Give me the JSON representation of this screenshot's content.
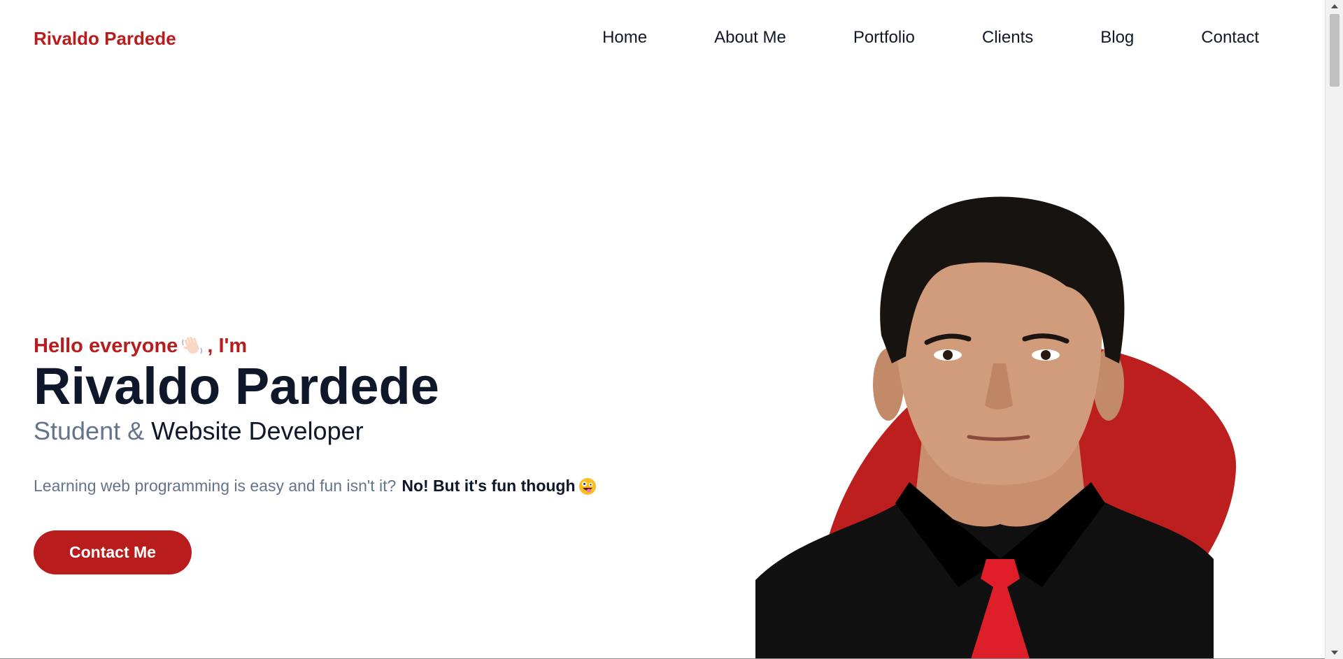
{
  "nav": {
    "brand": "Rivaldo Pardede",
    "links": [
      "Home",
      "About Me",
      "Portfolio",
      "Clients",
      "Blog",
      "Contact"
    ]
  },
  "hero": {
    "greeting_before": "Hello everyone",
    "greeting_after": ", I'm",
    "greeting_icon": "waving-hand",
    "name": "Rivaldo Pardede",
    "role_muted": "Student & ",
    "role_strong": "Website Developer",
    "tagline": "Learning web programming is easy and fun isn't it?",
    "tagline_bold": "No! But it's fun though",
    "tagline_icon": "zany-face",
    "cta_label": "Contact Me"
  },
  "colors": {
    "accent": "#b91c1c",
    "heading": "#0f172a",
    "muted": "#64748b"
  }
}
